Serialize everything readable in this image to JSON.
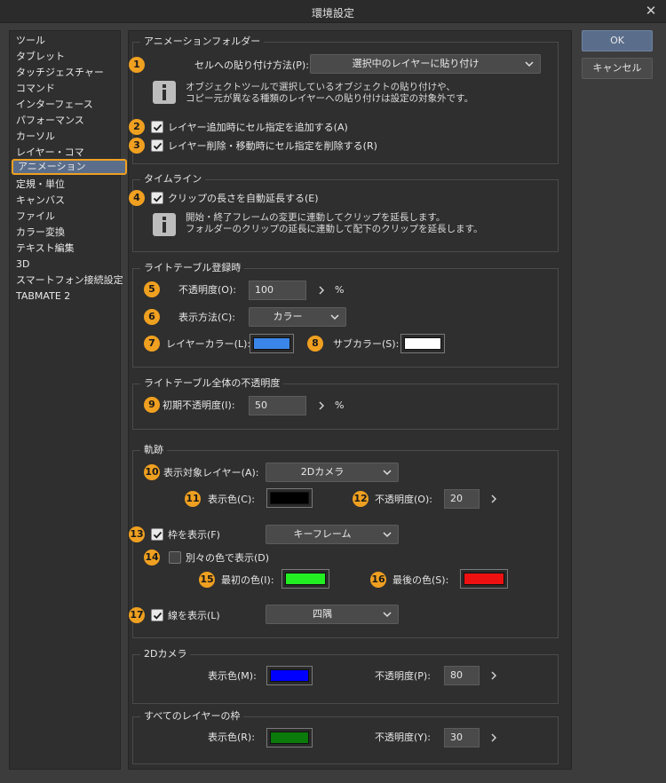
{
  "window": {
    "title": "環境設定"
  },
  "sidebar": {
    "items": [
      "ツール",
      "タブレット",
      "タッチジェスチャー",
      "コマンド",
      "インターフェース",
      "パフォーマンス",
      "カーソル",
      "レイヤー・コマ",
      "アニメーション",
      "定規・単位",
      "キャンバス",
      "ファイル",
      "カラー変換",
      "テキスト編集",
      "3D",
      "スマートフォン接続設定",
      "TABMATE 2"
    ],
    "active_index": 8
  },
  "buttons": {
    "ok": "OK",
    "cancel": "キャンセル"
  },
  "badges": [
    "1",
    "2",
    "3",
    "4",
    "5",
    "6",
    "7",
    "8",
    "9",
    "10",
    "11",
    "12",
    "13",
    "14",
    "15",
    "16",
    "17"
  ],
  "animation_folder": {
    "title": "アニメーションフォルダー",
    "paste_label": "セルへの貼り付け方法(P):",
    "paste_value": "選択中のレイヤーに貼り付け",
    "info_line1": "オブジェクトツールで選択しているオブジェクトの貼り付けや、",
    "info_line2": "コピー元が異なる種類のレイヤーへの貼り付けは設定の対象外です。",
    "add_cell_label": "レイヤー追加時にセル指定を追加する(A)",
    "delete_cell_label": "レイヤー削除・移動時にセル指定を削除する(R)"
  },
  "timeline": {
    "title": "タイムライン",
    "auto_extend_label": "クリップの長さを自動延長する(E)",
    "info_line1": "開始・終了フレームの変更に連動してクリップを延長します。",
    "info_line2": "フォルダーのクリップの延長に連動して配下のクリップを延長します。"
  },
  "light_table": {
    "title": "ライトテーブル登録時",
    "opacity_label": "不透明度(O):",
    "opacity_value": "100",
    "opacity_unit": "%",
    "display_label": "表示方法(C):",
    "display_value": "カラー",
    "layer_color_label": "レイヤーカラー(L):",
    "layer_color": "#3a86e8",
    "sub_color_label": "サブカラー(S):",
    "sub_color": "#ffffff"
  },
  "light_table_all": {
    "title": "ライトテーブル全体の不透明度",
    "initial_opacity_label": "初期不透明度(I):",
    "initial_opacity_value": "50",
    "unit": "%"
  },
  "trajectory": {
    "title": "軌跡",
    "target_layer_label": "表示対象レイヤー(A):",
    "target_layer_value": "2Dカメラ",
    "display_color_label": "表示色(C):",
    "display_color": "#000000",
    "opacity_label": "不透明度(O):",
    "opacity_value": "20",
    "frame_label": "枠を表示(F)",
    "frame_value": "キーフレーム",
    "separate_color_label": "別々の色で表示(D)",
    "first_color_label": "最初の色(I):",
    "first_color": "#22ee22",
    "last_color_label": "最後の色(S):",
    "last_color": "#ee1111",
    "line_label": "線を表示(L)",
    "line_value": "四隅"
  },
  "camera_2d": {
    "title": "2Dカメラ",
    "color_label": "表示色(M):",
    "color": "#0000ff",
    "opacity_label": "不透明度(P):",
    "opacity_value": "80"
  },
  "all_layer_frame": {
    "title": "すべてのレイヤーの枠",
    "color_label": "表示色(R):",
    "color": "#0a7a0a",
    "opacity_label": "不透明度(Y):",
    "opacity_value": "30"
  }
}
